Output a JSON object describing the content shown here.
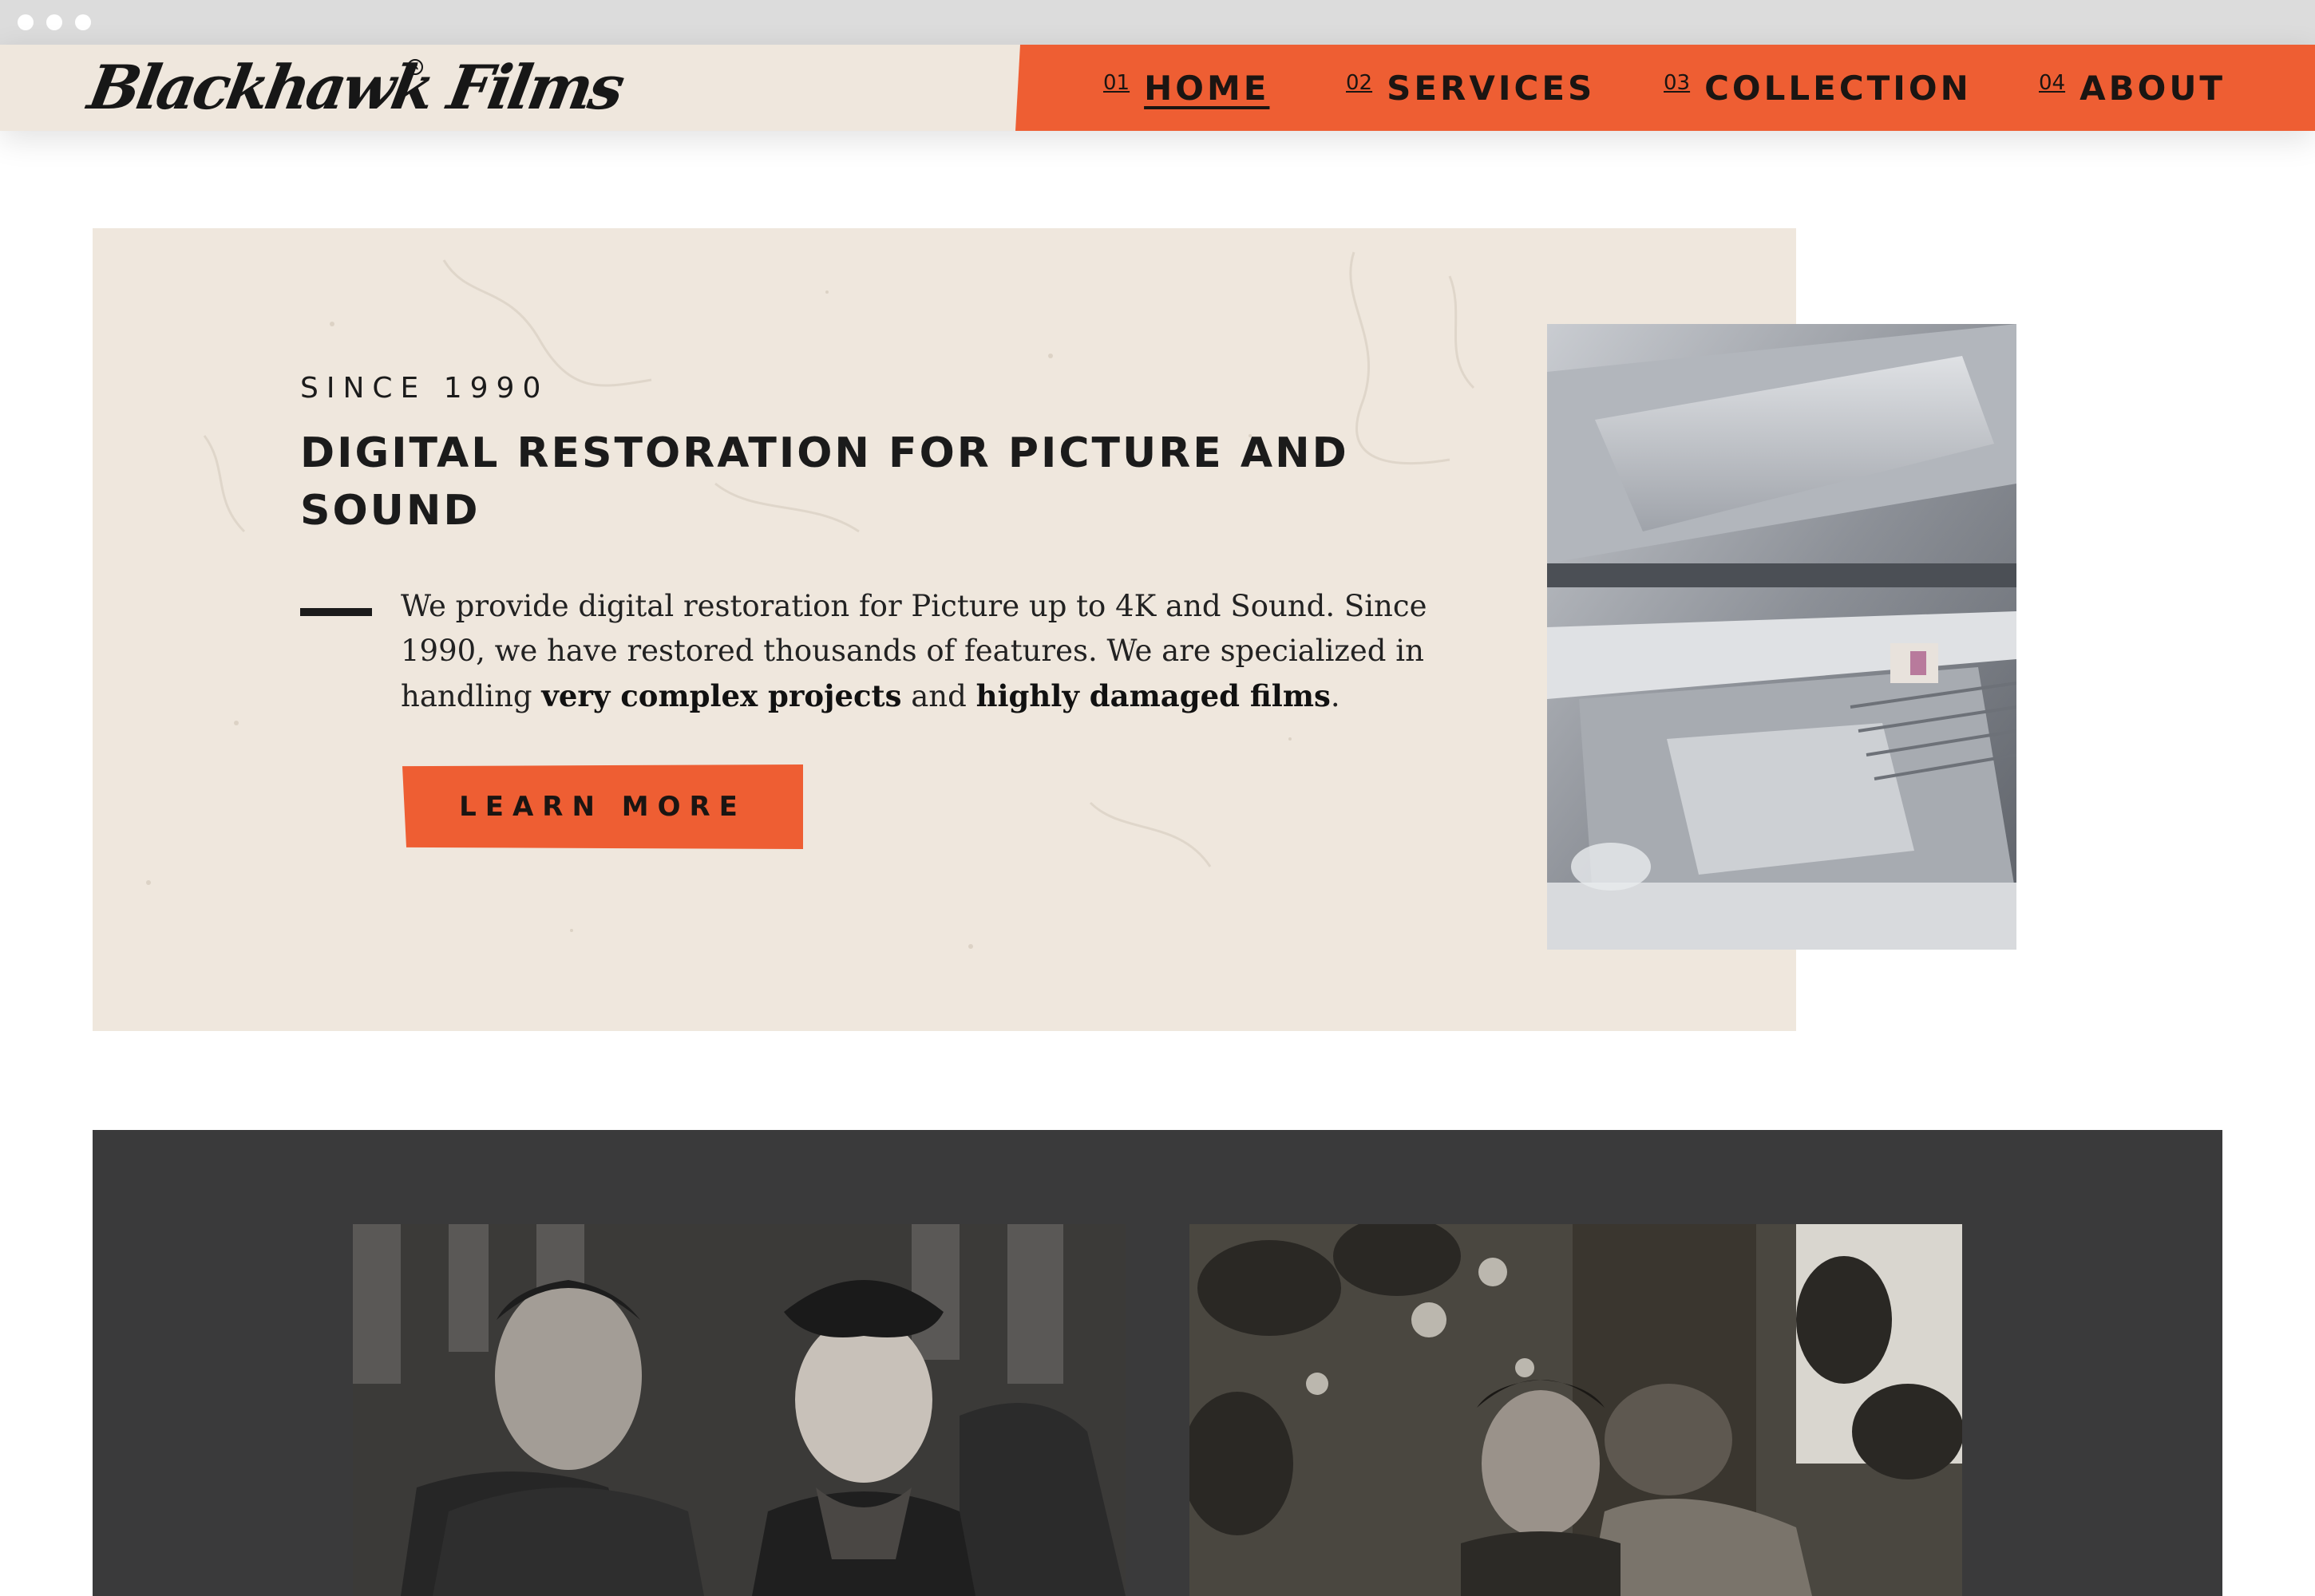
{
  "brand": {
    "logo_text": "Blackhawk Films",
    "registered_mark": "R",
    "accent_color": "#ee5e33",
    "paper_color": "#efe7dd",
    "ink_color": "#1b1b1b",
    "dark_panel_color": "#3a3a3b"
  },
  "nav": {
    "items": [
      {
        "number": "01",
        "label": "HOME",
        "active": true
      },
      {
        "number": "02",
        "label": "SERVICES",
        "active": false
      },
      {
        "number": "03",
        "label": "COLLECTION",
        "active": false
      },
      {
        "number": "04",
        "label": "ABOUT",
        "active": false
      }
    ]
  },
  "hero": {
    "eyebrow": "SINCE 1990",
    "title": "DIGITAL RESTORATION FOR PICTURE AND SOUND",
    "body_intro": "We provide digital restoration for Picture up to 4K and Sound. Since 1990, we have restored thousands of features. We are specialized in handling ",
    "body_bold_1": "very complex projects",
    "body_mid": " and ",
    "body_bold_2": "highly damaged films",
    "body_end": ".",
    "cta_label": "LEARN MORE",
    "photo_icon": "film-scanner-machine-photo"
  },
  "showcase": {
    "stills": [
      {
        "icon": "black-and-white-couple-film-still"
      },
      {
        "icon": "black-and-white-forest-film-still"
      }
    ]
  }
}
